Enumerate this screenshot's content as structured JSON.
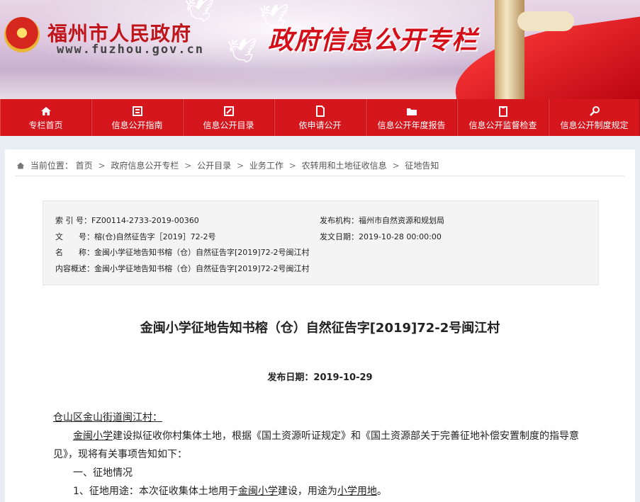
{
  "header": {
    "site_name": "福州市人民政府",
    "site_url": "www.fuzhou.gov.cn",
    "column_title": "政府信息公开专栏"
  },
  "nav": {
    "items": [
      {
        "label": "专栏首页",
        "icon": "home-icon"
      },
      {
        "label": "信息公开指南",
        "icon": "guide-icon"
      },
      {
        "label": "信息公开目录",
        "icon": "catalog-icon"
      },
      {
        "label": "依申请公开",
        "icon": "document-icon"
      },
      {
        "label": "信息公开年度报告",
        "icon": "folder-icon"
      },
      {
        "label": "信息公开监督检查",
        "icon": "clipboard-icon"
      },
      {
        "label": "信息公开制度规定",
        "icon": "magnifier-icon"
      }
    ]
  },
  "breadcrumb": {
    "prefix": "当前位置：",
    "items": [
      "首页",
      "政府信息公开专栏",
      "公开目录",
      "业务工作",
      "农转用和土地征收信息",
      "征地告知"
    ],
    "separator": ">"
  },
  "meta": {
    "index_label": "索 引 号：",
    "index_value": "FZ00114-2733-2019-00360",
    "doc_no_label": "文　　号：",
    "doc_no_value": "榕(仓)自然征告字［2019］72-2号",
    "name_label": "名　　称：",
    "name_value": "金闽小学征地告知书榕（仓）自然征告字[2019]72-2号闽江村",
    "summary_label": "内容概述：",
    "summary_value": "金闽小学征地告知书榕（仓）自然征告字[2019]72-2号闽江村",
    "publisher_label": "发布机构：",
    "publisher_value": "福州市自然资源和规划局",
    "date_label": "发文日期：",
    "date_value": "2019-10-28 00:00:00"
  },
  "article": {
    "title": "金闽小学征地告知书榕（仓）自然征告字[2019]72-2号闽江村",
    "publish_label": "发布日期：",
    "publish_date": "2019-10-29",
    "line1": "仓山区金山街道闽江村：",
    "line2a": "金闽小学",
    "line2b": "建设拟征收你村集体土地，根据《国土资源听证规定》和《国土资源部关于完善征地补偿安置制度的指导意见》，现将有关事项告知如下：",
    "line3": "一、征地情况",
    "line4a": "1、征地用途：本次征收集体土地用于",
    "line4b": "金闽小学",
    "line4c": "建设，用途为",
    "line4d": "小学用地",
    "line4e": "。"
  },
  "colors": {
    "nav_red": "#d5161d",
    "brand_red": "#c0161b"
  }
}
